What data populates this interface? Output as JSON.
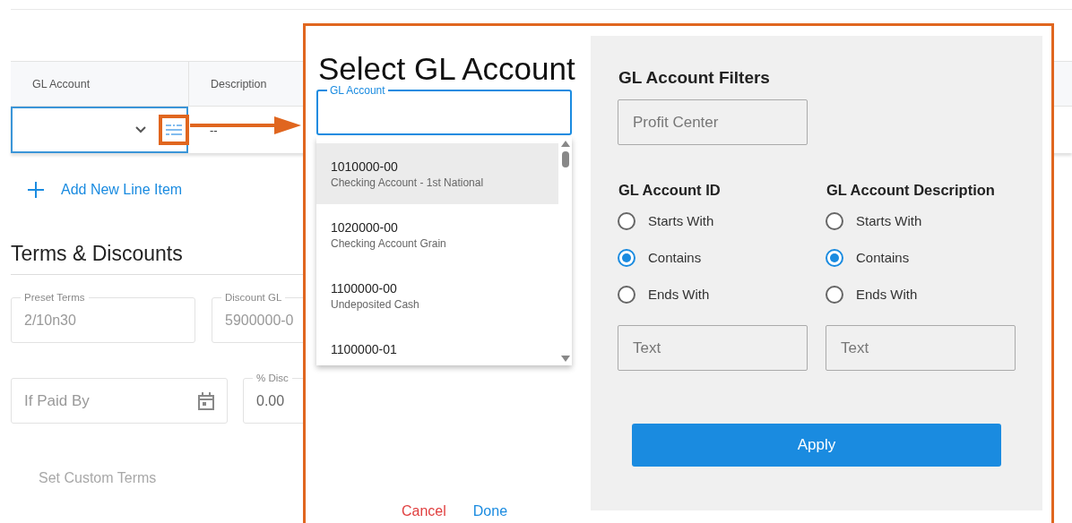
{
  "page": {
    "table": {
      "columns": [
        {
          "label": "GL Account"
        },
        {
          "label": "Description"
        }
      ],
      "row": {
        "gl_account": {
          "focused": true
        },
        "description": "--"
      }
    },
    "add_line_button": {
      "label": "Add New Line Item"
    },
    "section_title": "Terms & Discounts",
    "terms_fields": [
      {
        "label": "Preset Terms",
        "value": "2/10n30",
        "disabled": true
      },
      {
        "label": "Discount GL",
        "value": "5900000-0",
        "disabled": true
      }
    ],
    "payment_fields": [
      {
        "kind": "date",
        "placeholder": "If Paid By"
      },
      {
        "kind": "text",
        "label": "% Disc",
        "value": "0.00"
      }
    ],
    "custom_terms_button": {
      "label": "Set Custom Terms",
      "disabled": true
    }
  },
  "dialog": {
    "title": "Select GL Account",
    "search_field": {
      "label": "GL Account",
      "focused": true
    },
    "options": [
      {
        "number": "1010000-00",
        "name": "Checking Account - 1st National",
        "selected": true
      },
      {
        "number": "1020000-00",
        "name": "Checking Account Grain",
        "selected": false
      },
      {
        "number": "1100000-00",
        "name": "Undeposited Cash",
        "selected": false
      },
      {
        "number": "1100000-01",
        "selected": false
      }
    ],
    "filters": {
      "title": "GL Account Filters",
      "profit_center": {
        "placeholder": "Profit Center"
      },
      "groups": [
        {
          "title": "GL Account ID",
          "modes": [
            {
              "label": "Starts With",
              "selected": false
            },
            {
              "label": "Contains",
              "selected": true
            },
            {
              "label": "Ends With",
              "selected": false
            }
          ],
          "text_field": {
            "placeholder": "Text"
          }
        },
        {
          "title": "GL Account Description",
          "modes": [
            {
              "label": "Starts With",
              "selected": false
            },
            {
              "label": "Contains",
              "selected": true
            },
            {
              "label": "Ends With",
              "selected": false
            }
          ],
          "text_field": {
            "placeholder": "Text"
          }
        }
      ],
      "apply_button": {
        "label": "Apply"
      }
    },
    "actions": [
      {
        "kind": "cancel",
        "label": "Cancel"
      },
      {
        "kind": "confirm",
        "label": "Done"
      }
    ]
  }
}
